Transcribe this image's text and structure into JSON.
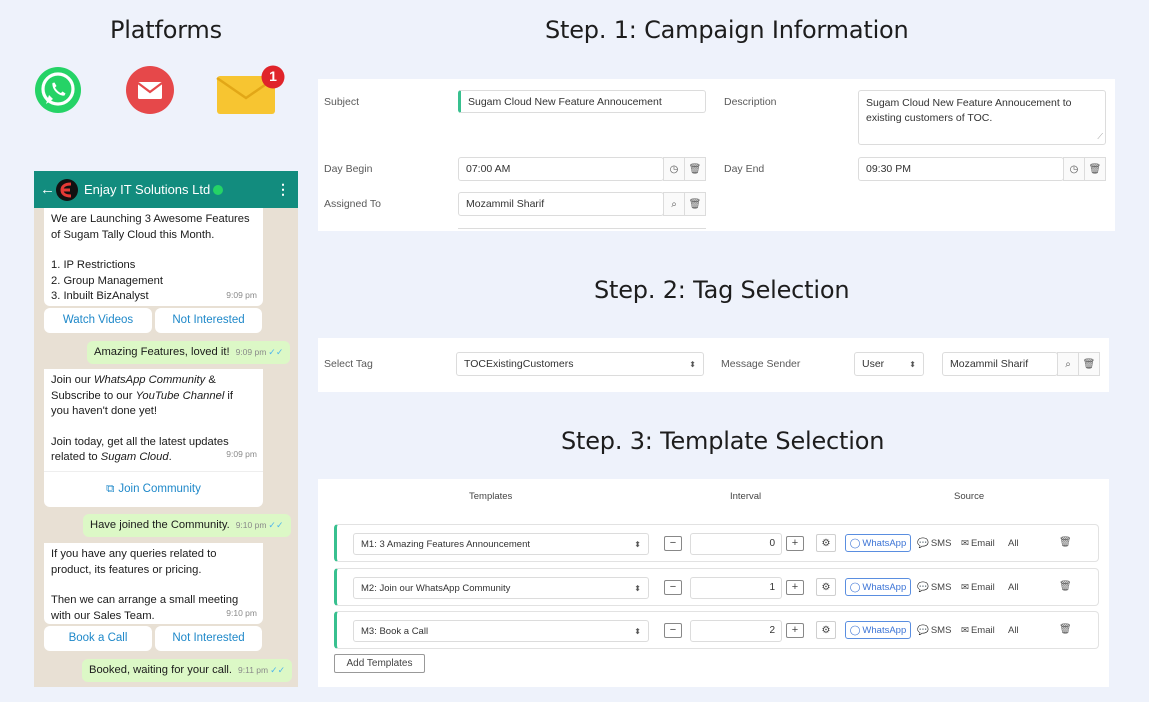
{
  "headings": {
    "platforms": "Platforms",
    "step1": "Step. 1: Campaign Information",
    "step2": "Step. 2: Tag Selection",
    "step3": "Step. 3: Template Selection"
  },
  "platforms": {
    "icons": [
      "whatsapp-icon",
      "gmail-icon",
      "envelope-icon"
    ],
    "envelope_badge": "1",
    "colors": {
      "whatsapp": "#25d366",
      "gmail": "#e6484a",
      "envelope": "#f7c531",
      "badge": "#e0242a"
    }
  },
  "chat": {
    "contact_name": "Enjay IT Solutions Ltd",
    "messages": {
      "m1_lines": [
        "We are Launching 3 Awesome Features",
        "of Sugam Tally Cloud this Month.",
        "",
        "1. IP Restrictions",
        "2. Group Management",
        "3. Inbuilt BizAnalyst"
      ],
      "m1_time": "9:09 pm",
      "m1_btn1": "Watch Videos",
      "m1_btn2": "Not Interested",
      "r1": "Amazing Features, loved it!",
      "r1_time": "9:09 pm",
      "m2_line1_a": "Join our ",
      "m2_line1_b": "WhatsApp Community",
      "m2_line1_c": " &",
      "m2_line2_a": "Subscribe to our ",
      "m2_line2_b": "YouTube Channel",
      "m2_line2_c": " if",
      "m2_line3": "you haven't done yet!",
      "m2_line4": "Join today, get all the latest updates",
      "m2_line5_a": "related to ",
      "m2_line5_b": "Sugam Cloud",
      "m2_line5_c": ".",
      "m2_time": "9:09 pm",
      "m2_link": "Join Community",
      "r2": "Have joined the Community.",
      "r2_time": "9:10 pm",
      "m3_lines": [
        "If you have any queries related to",
        "product, its features or pricing.",
        "",
        "Then we can arrange a small meeting",
        "with our Sales Team."
      ],
      "m3_time": "9:10 pm",
      "m3_btn1": "Book a Call",
      "m3_btn2": "Not Interested",
      "r3": "Booked, waiting for your call.",
      "r3_time": "9:11 pm"
    }
  },
  "step1": {
    "subject_label": "Subject",
    "subject_value": "Sugam Cloud New Feature Annoucement",
    "description_label": "Description",
    "description_value": "Sugam Cloud New Feature Annoucement to existing customers of TOC.",
    "day_begin_label": "Day Begin",
    "day_begin_value": "07:00 AM",
    "day_end_label": "Day End",
    "day_end_value": "09:30 PM",
    "assigned_label": "Assigned To",
    "assigned_value": "Mozammil Sharif"
  },
  "step2": {
    "tag_label": "Select Tag",
    "tag_value": "TOCExistingCustomers",
    "sender_label": "Message Sender",
    "sender_type": "User",
    "sender_name": "Mozammil Sharif"
  },
  "step3": {
    "col_templates": "Templates",
    "col_interval": "Interval",
    "col_source": "Source",
    "rows": [
      {
        "template": "M1: 3 Amazing Features Announcement",
        "interval": "0"
      },
      {
        "template": "M2: Join our WhatsApp Community",
        "interval": "1"
      },
      {
        "template": "M3: Book a Call",
        "interval": "2"
      }
    ],
    "src_whatsapp": "WhatsApp",
    "src_sms": "SMS",
    "src_email": "Email",
    "src_all": "All",
    "add_button": "Add Templates"
  }
}
